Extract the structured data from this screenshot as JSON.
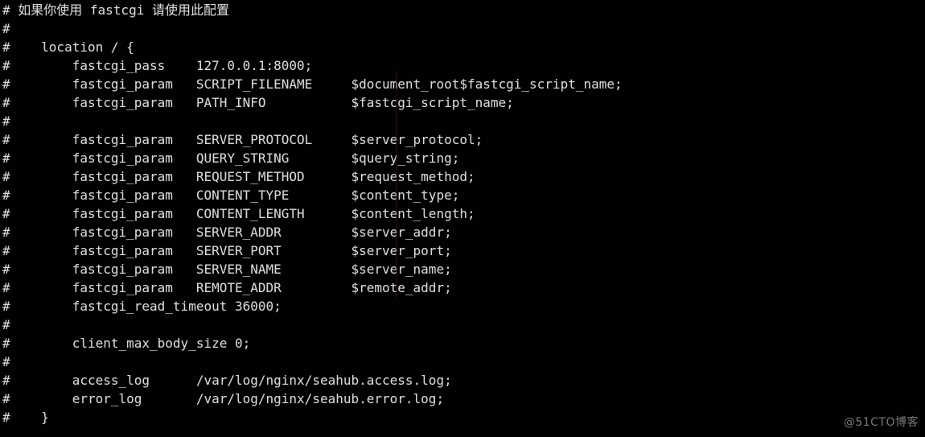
{
  "document": {
    "type": "nginx-configuration-comment-block",
    "background_color": "#010101",
    "text_color": "#d8d8d8",
    "lines": [
      "# 如果你使用 fastcgi 请使用此配置",
      "#",
      "#    location / {",
      "#        fastcgi_pass    127.0.0.1:8000;",
      "#        fastcgi_param   SCRIPT_FILENAME     $document_root$fastcgi_script_name;",
      "#        fastcgi_param   PATH_INFO           $fastcgi_script_name;",
      "#",
      "#        fastcgi_param   SERVER_PROTOCOL     $server_protocol;",
      "#        fastcgi_param   QUERY_STRING        $query_string;",
      "#        fastcgi_param   REQUEST_METHOD      $request_method;",
      "#        fastcgi_param   CONTENT_TYPE        $content_type;",
      "#        fastcgi_param   CONTENT_LENGTH      $content_length;",
      "#        fastcgi_param   SERVER_ADDR         $server_addr;",
      "#        fastcgi_param   SERVER_PORT         $server_port;",
      "#        fastcgi_param   SERVER_NAME         $server_name;",
      "#        fastcgi_param   REMOTE_ADDR         $remote_addr;",
      "#        fastcgi_read_timeout 36000;",
      "#",
      "#        client_max_body_size 0;",
      "#",
      "#        access_log      /var/log/nginx/seahub.access.log;",
      "#        error_log       /var/log/nginx/seahub.error.log;",
      "#    }"
    ]
  },
  "watermark": {
    "text": "@51CTO博客"
  }
}
